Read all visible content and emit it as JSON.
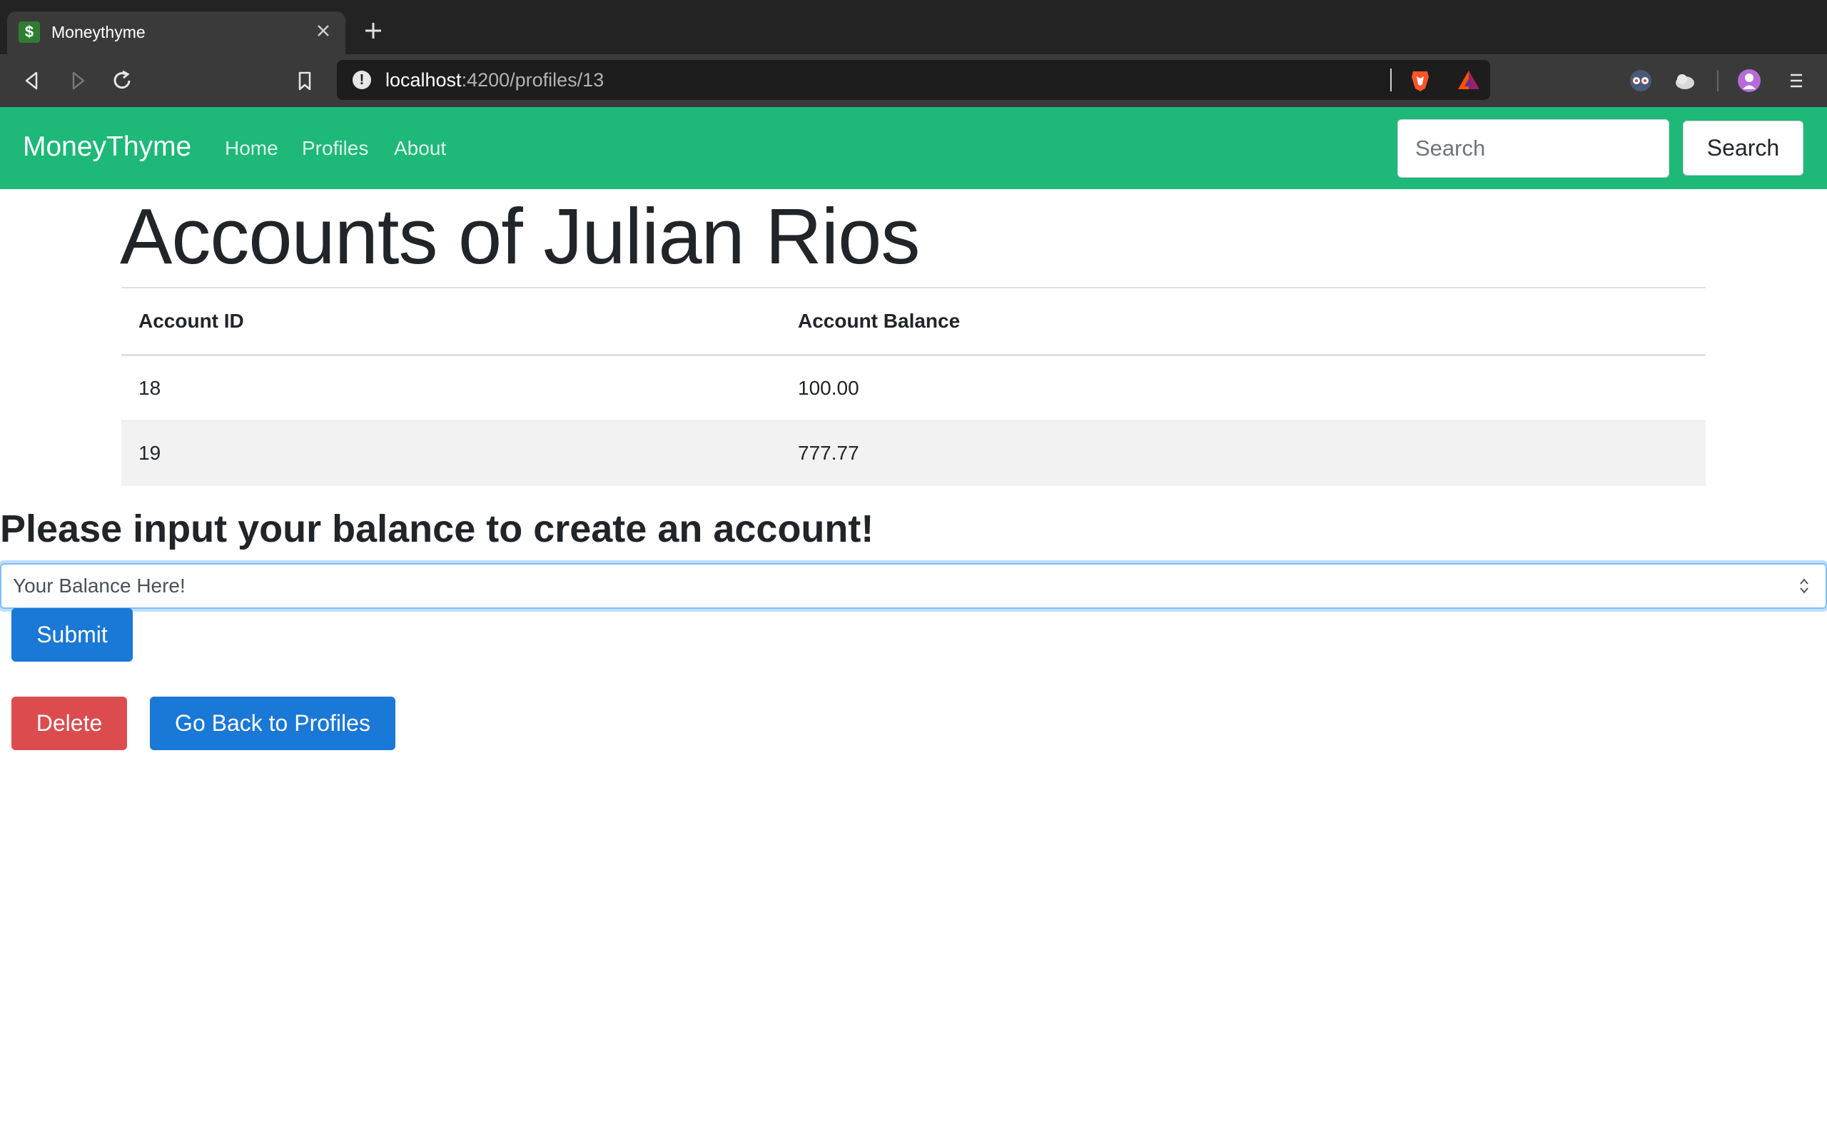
{
  "browser": {
    "tab_title": "Moneythyme",
    "favicon_glyph": "$",
    "url_host": "localhost",
    "url_rest": ":4200/profiles/13"
  },
  "navbar": {
    "brand": "MoneyThyme",
    "links": [
      "Home",
      "Profiles",
      "About"
    ],
    "search_placeholder": "Search",
    "search_button": "Search",
    "bg_color": "#1eb879"
  },
  "page": {
    "title": "Accounts of Julian Rios"
  },
  "accounts_table": {
    "headers": [
      "Account ID",
      "Account Balance"
    ],
    "rows": [
      [
        "18",
        "100.00"
      ],
      [
        "19",
        "777.77"
      ]
    ]
  },
  "create_form": {
    "heading": "Please input your balance to create an account!",
    "input_placeholder": "Your Balance Here!",
    "submit_label": "Submit"
  },
  "actions": {
    "delete_label": "Delete",
    "back_label": "Go Back to Profiles"
  }
}
